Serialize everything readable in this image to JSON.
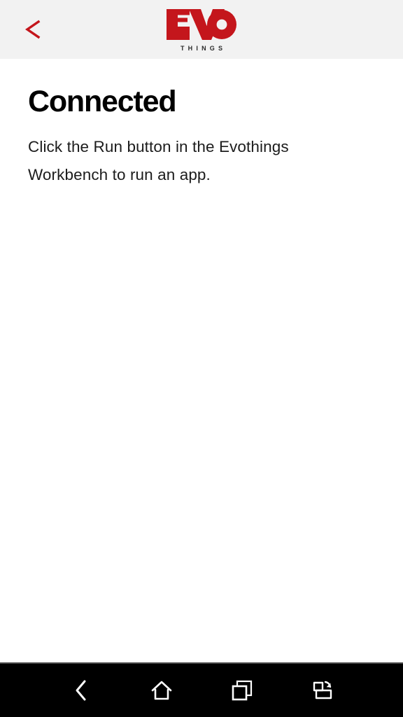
{
  "header": {
    "back_button": {
      "icon": "chevron-left-icon",
      "label": "<",
      "color": "#c4161c"
    },
    "logo": {
      "wordmark": "EVO",
      "subtitle": "THINGS",
      "color": "#c4161c",
      "subtitle_color": "#2b2b2b"
    },
    "background": "#f2f2f2"
  },
  "main": {
    "title": "Connected",
    "body": "Click the Run button in the Evothings Workbench to run an app.",
    "background": "#ffffff"
  },
  "navbar": {
    "background": "#000000",
    "icon_color": "#ffffff",
    "buttons": [
      {
        "name": "back",
        "icon": "chevron-left-icon",
        "label": "Back"
      },
      {
        "name": "home",
        "icon": "home-icon",
        "label": "Home"
      },
      {
        "name": "recents",
        "icon": "overlapping-squares-icon",
        "label": "Recent apps"
      },
      {
        "name": "rotate",
        "icon": "screen-rotate-icon",
        "label": "Rotate screen"
      }
    ]
  }
}
